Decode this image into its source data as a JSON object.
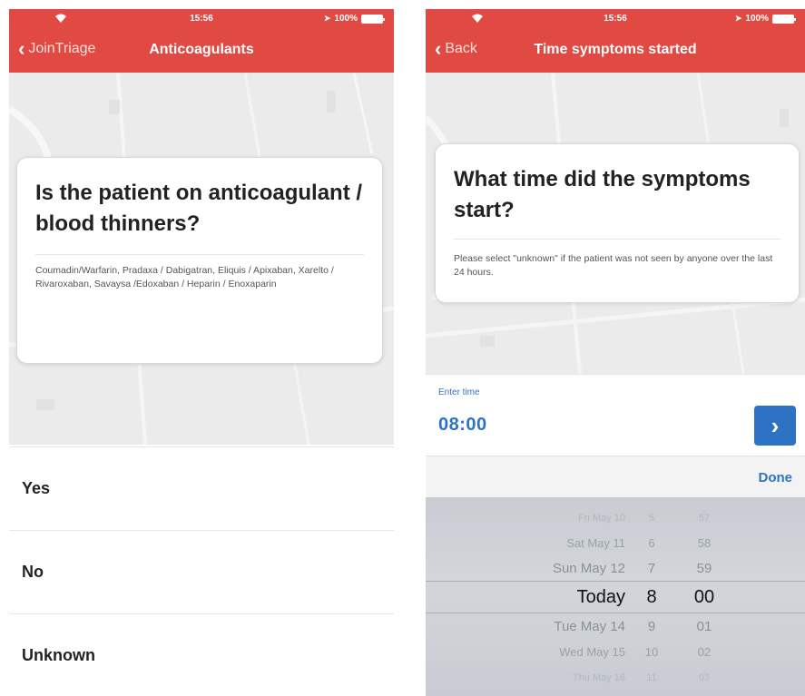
{
  "colors": {
    "header": "#e04a43",
    "accent": "#2e72c4",
    "map": "#ebebeb",
    "picker": "#d0d3d8"
  },
  "status_bar": {
    "time": "15:56",
    "battery": "100%"
  },
  "left_screen": {
    "nav": {
      "back_label": "JoinTriage",
      "title": "Anticoagulants"
    },
    "question": "Is the patient on anticoagulant / blood thinners?",
    "hint": "Coumadin/Warfarin, Pradaxa / Dabigatran, Eliquis / Apixaban, Xarelto / Rivaroxaban, Savaysa /Edoxaban / Heparin / Enoxaparin",
    "options": [
      "Yes",
      "No",
      "Unknown"
    ]
  },
  "right_screen": {
    "nav": {
      "back_label": "Back",
      "title": "Time symptoms started"
    },
    "question": "What time did the symptoms start?",
    "hint": "Please select \"unknown\" if the patient was not seen by anyone over the last 24 hours.",
    "time_input": {
      "label": "Enter time",
      "value": "08:00"
    },
    "done_label": "Done",
    "picker": {
      "days": [
        "Fri May 10",
        "Sat May 11",
        "Sun May 12",
        "Today",
        "Tue May 14",
        "Wed May 15",
        "Thu May 16"
      ],
      "hours": [
        "5",
        "6",
        "7",
        "8",
        "9",
        "10",
        "11"
      ],
      "minutes": [
        "57",
        "58",
        "59",
        "00",
        "01",
        "02",
        "03"
      ],
      "selected_index": 3
    }
  }
}
